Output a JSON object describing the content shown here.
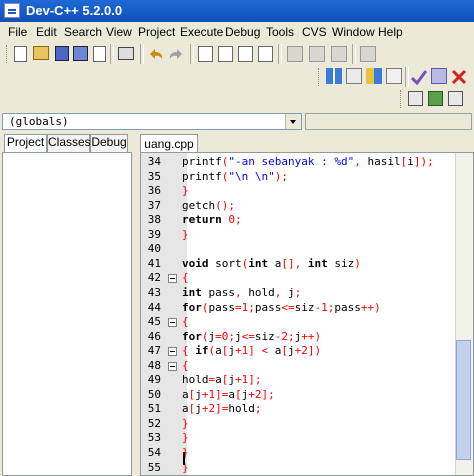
{
  "window": {
    "title": "Dev-C++ 5.2.0.0"
  },
  "menu": [
    "File",
    "Edit",
    "Search",
    "View",
    "Project",
    "Execute",
    "Debug",
    "Tools",
    "CVS",
    "Window",
    "Help"
  ],
  "scope_combo": {
    "value": "(globals)"
  },
  "left_tabs": [
    "Project",
    "Classes",
    "Debug"
  ],
  "editor": {
    "file_tab": "uang.cpp",
    "lines": [
      {
        "n": "34",
        "text": "printf(\"-an sebanyak : %d\", hasil[i]);"
      },
      {
        "n": "35",
        "text": "printf(\"\\n \\n\");"
      },
      {
        "n": "36",
        "text": "}"
      },
      {
        "n": "37",
        "text": "getch();"
      },
      {
        "n": "38",
        "text": "return 0;"
      },
      {
        "n": "39",
        "text": "}"
      },
      {
        "n": "40",
        "text": ""
      },
      {
        "n": "41",
        "text": "void sort(int a[], int siz)"
      },
      {
        "n": "42",
        "text": "{"
      },
      {
        "n": "43",
        "text": "int pass, hold, j;"
      },
      {
        "n": "44",
        "text": "for(pass=1;pass<=siz-1;pass++)"
      },
      {
        "n": "45",
        "text": "{"
      },
      {
        "n": "46",
        "text": "for(j=0;j<=siz-2;j++)"
      },
      {
        "n": "47",
        "text": "{ if(a[j+1] < a[j+2])"
      },
      {
        "n": "48",
        "text": "{"
      },
      {
        "n": "49",
        "text": "hold=a[j+1];"
      },
      {
        "n": "50",
        "text": "a[j+1]=a[j+2];"
      },
      {
        "n": "51",
        "text": "a[j+2]=hold;"
      },
      {
        "n": "52",
        "text": "}"
      },
      {
        "n": "53",
        "text": "}"
      },
      {
        "n": "54",
        "text": "}"
      },
      {
        "n": "55",
        "text": "}"
      }
    ],
    "fold_lines": [
      "42",
      "45",
      "47",
      "48"
    ]
  },
  "colors": {
    "titlebar": "#0f4fb8",
    "string": "#0000ff",
    "number": "#ff0000",
    "symbol": "#ff0000"
  }
}
